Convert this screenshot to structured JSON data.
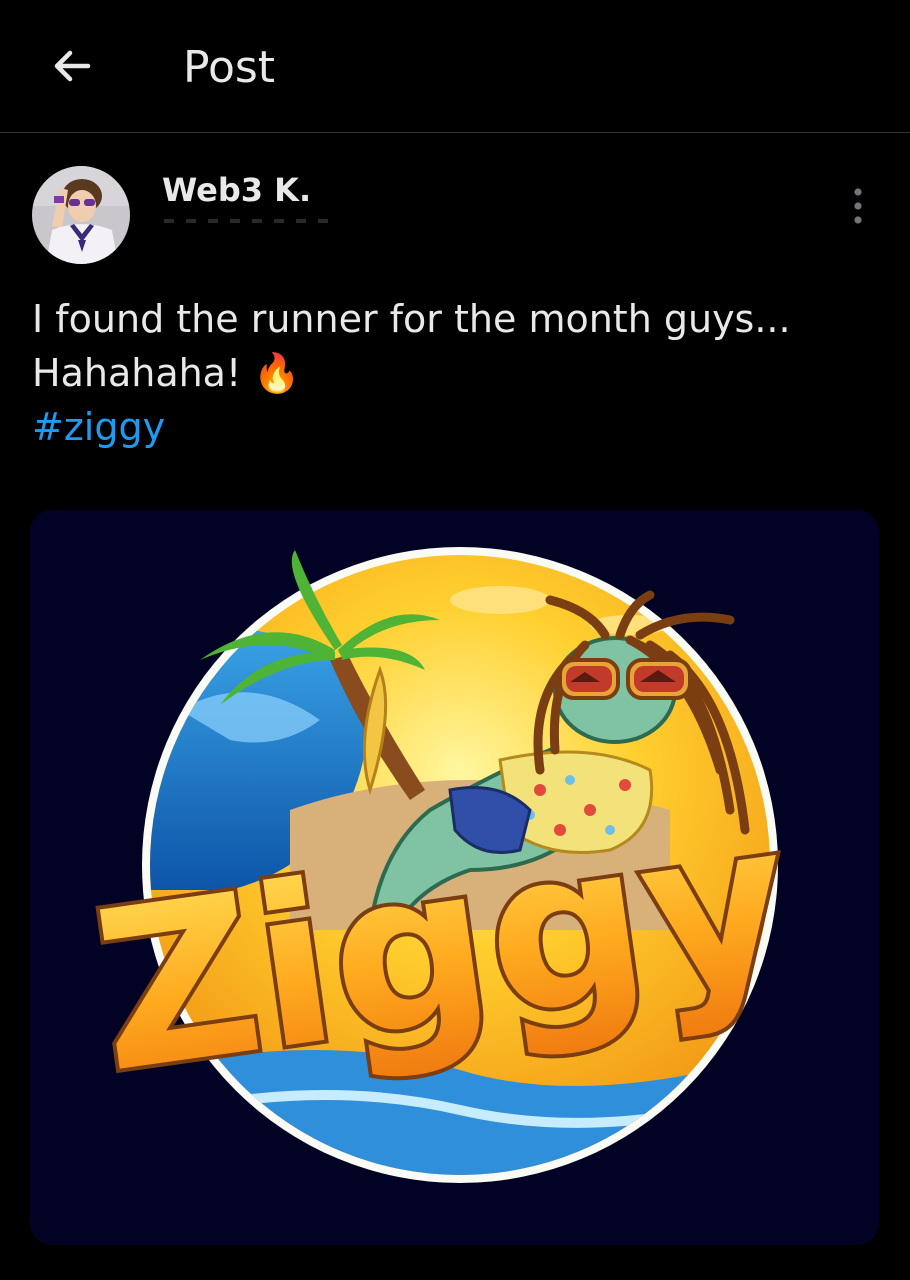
{
  "header": {
    "back_icon": "arrow-left-icon",
    "title": "Post"
  },
  "author": {
    "display_name": "Web3 K.",
    "avatar_icon": "avatar-photo",
    "more_icon": "more-vertical-icon"
  },
  "post": {
    "line1": "I found the runner for the month guys...",
    "line2": "Hahahaha!",
    "emoji": "🔥",
    "hashtag": "#ziggy"
  },
  "media": {
    "logo_text": "Ziggy"
  },
  "colors": {
    "background": "#000000",
    "text": "#e7e9ea",
    "link": "#1d9bf0",
    "divider": "#2f3336"
  }
}
